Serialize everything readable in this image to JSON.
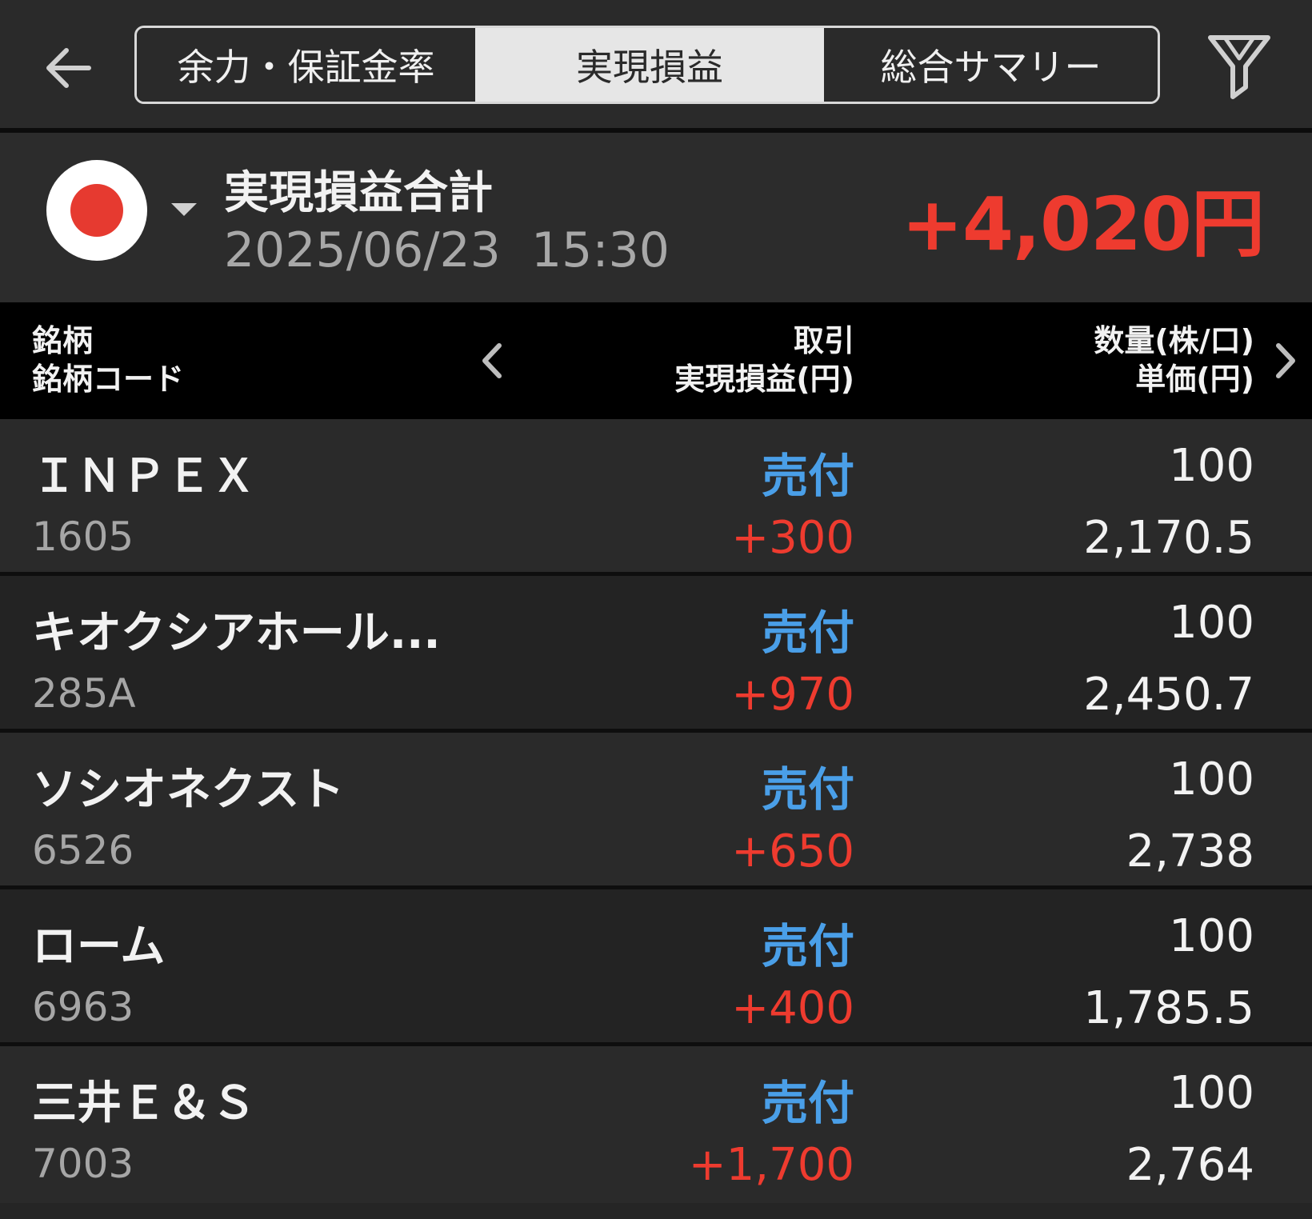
{
  "tabs": [
    {
      "label": "余力・保証金率"
    },
    {
      "label": "実現損益"
    },
    {
      "label": "総合サマリー"
    }
  ],
  "summary": {
    "title": "実現損益合計",
    "date": "2025/06/23  15:30",
    "total": "+4,020円"
  },
  "table_header": {
    "col1_line1": "銘柄",
    "col1_line2": "銘柄コード",
    "col2_line1": "取引",
    "col2_line2": "実現損益(円)",
    "col3_line1": "数量(株/口)",
    "col3_line2": "単価(円)"
  },
  "rows": [
    {
      "name": "ＩＮＰＥＸ",
      "code": "1605",
      "side": "売付",
      "pl": "+300",
      "qty": "100",
      "price": "2,170.5"
    },
    {
      "name": "キオクシアホール...",
      "code": "285A",
      "side": "売付",
      "pl": "+970",
      "qty": "100",
      "price": "2,450.7"
    },
    {
      "name": "ソシオネクスト",
      "code": "6526",
      "side": "売付",
      "pl": "+650",
      "qty": "100",
      "price": "2,738"
    },
    {
      "name": "ローム",
      "code": "6963",
      "side": "売付",
      "pl": "+400",
      "qty": "100",
      "price": "1,785.5"
    },
    {
      "name": "三井Ｅ＆Ｓ",
      "code": "7003",
      "side": "売付",
      "pl": "+1,700",
      "qty": "100",
      "price": "2,764"
    }
  ],
  "colors": {
    "background": "#252525",
    "profit_red": "#ee3b2f",
    "side_blue": "#4a9fe8",
    "active_tab": "#e6e6e6"
  },
  "icons": [
    "back-arrow-icon",
    "filter-icon",
    "japan-flag-icon",
    "dropdown-caret-icon",
    "chevron-left-icon",
    "chevron-right-icon"
  ]
}
